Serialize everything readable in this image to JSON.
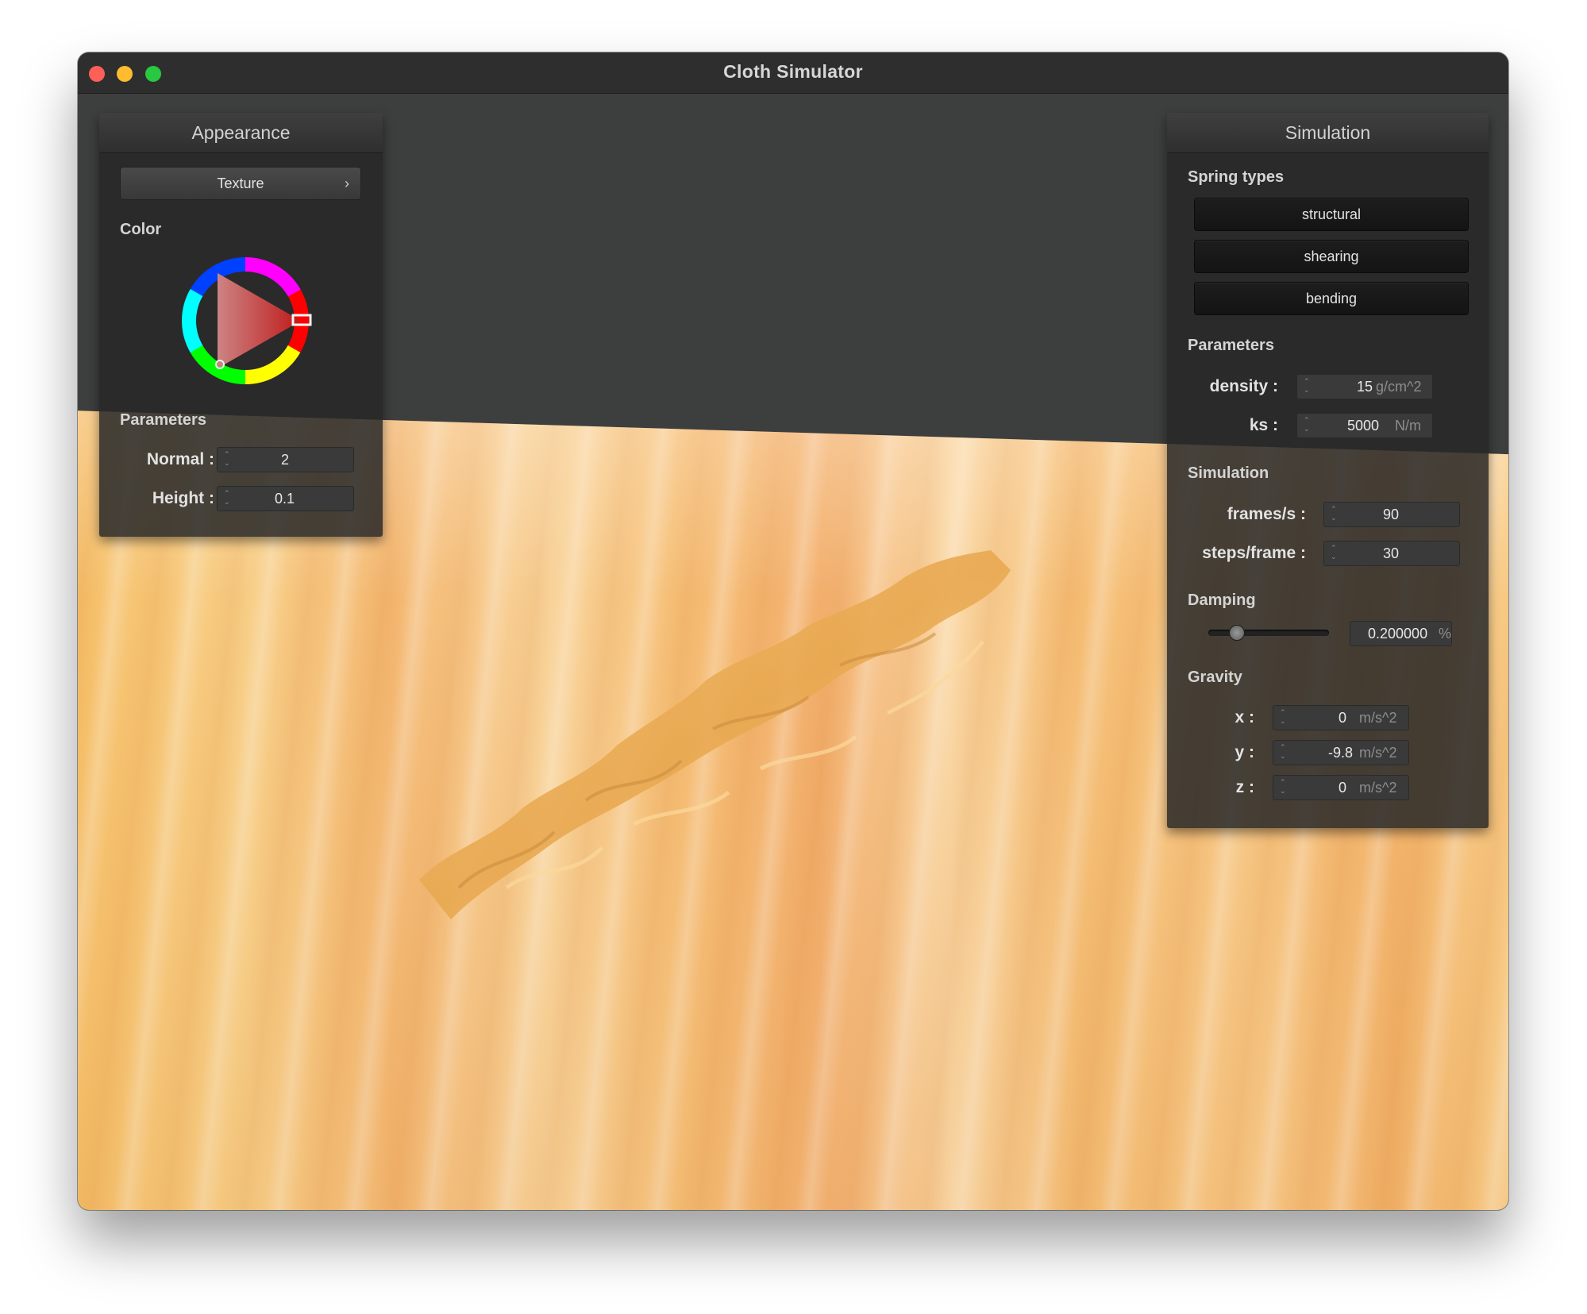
{
  "window": {
    "title": "Cloth Simulator"
  },
  "appearance": {
    "header": "Appearance",
    "texture_button": "Texture",
    "texture_chevron": "›",
    "color_label": "Color",
    "color_value": "#e02020",
    "parameters_label": "Parameters",
    "normal": {
      "label": "Normal :",
      "value": "2"
    },
    "height": {
      "label": "Height :",
      "value": "0.1"
    }
  },
  "simulation": {
    "header": "Simulation",
    "spring_types_label": "Spring types",
    "spring_buttons": [
      "structural",
      "shearing",
      "bending"
    ],
    "parameters_label": "Parameters",
    "density": {
      "label": "density :",
      "value": "15",
      "unit": "g/cm^2"
    },
    "ks": {
      "label": "ks :",
      "value": "5000",
      "unit": "N/m"
    },
    "simulation_label": "Simulation",
    "frames_per_s": {
      "label": "frames/s :",
      "value": "90"
    },
    "steps_per_frame": {
      "label": "steps/frame :",
      "value": "30"
    },
    "damping_label": "Damping",
    "damping": {
      "value": "0.200000",
      "unit": "%",
      "fraction": 0.2
    },
    "gravity_label": "Gravity",
    "gravity": {
      "x": {
        "label": "x :",
        "value": "0",
        "unit": "m/s^2"
      },
      "y": {
        "label": "y :",
        "value": "-9.8",
        "unit": "m/s^2"
      },
      "z": {
        "label": "z :",
        "value": "0",
        "unit": "m/s^2"
      }
    }
  }
}
